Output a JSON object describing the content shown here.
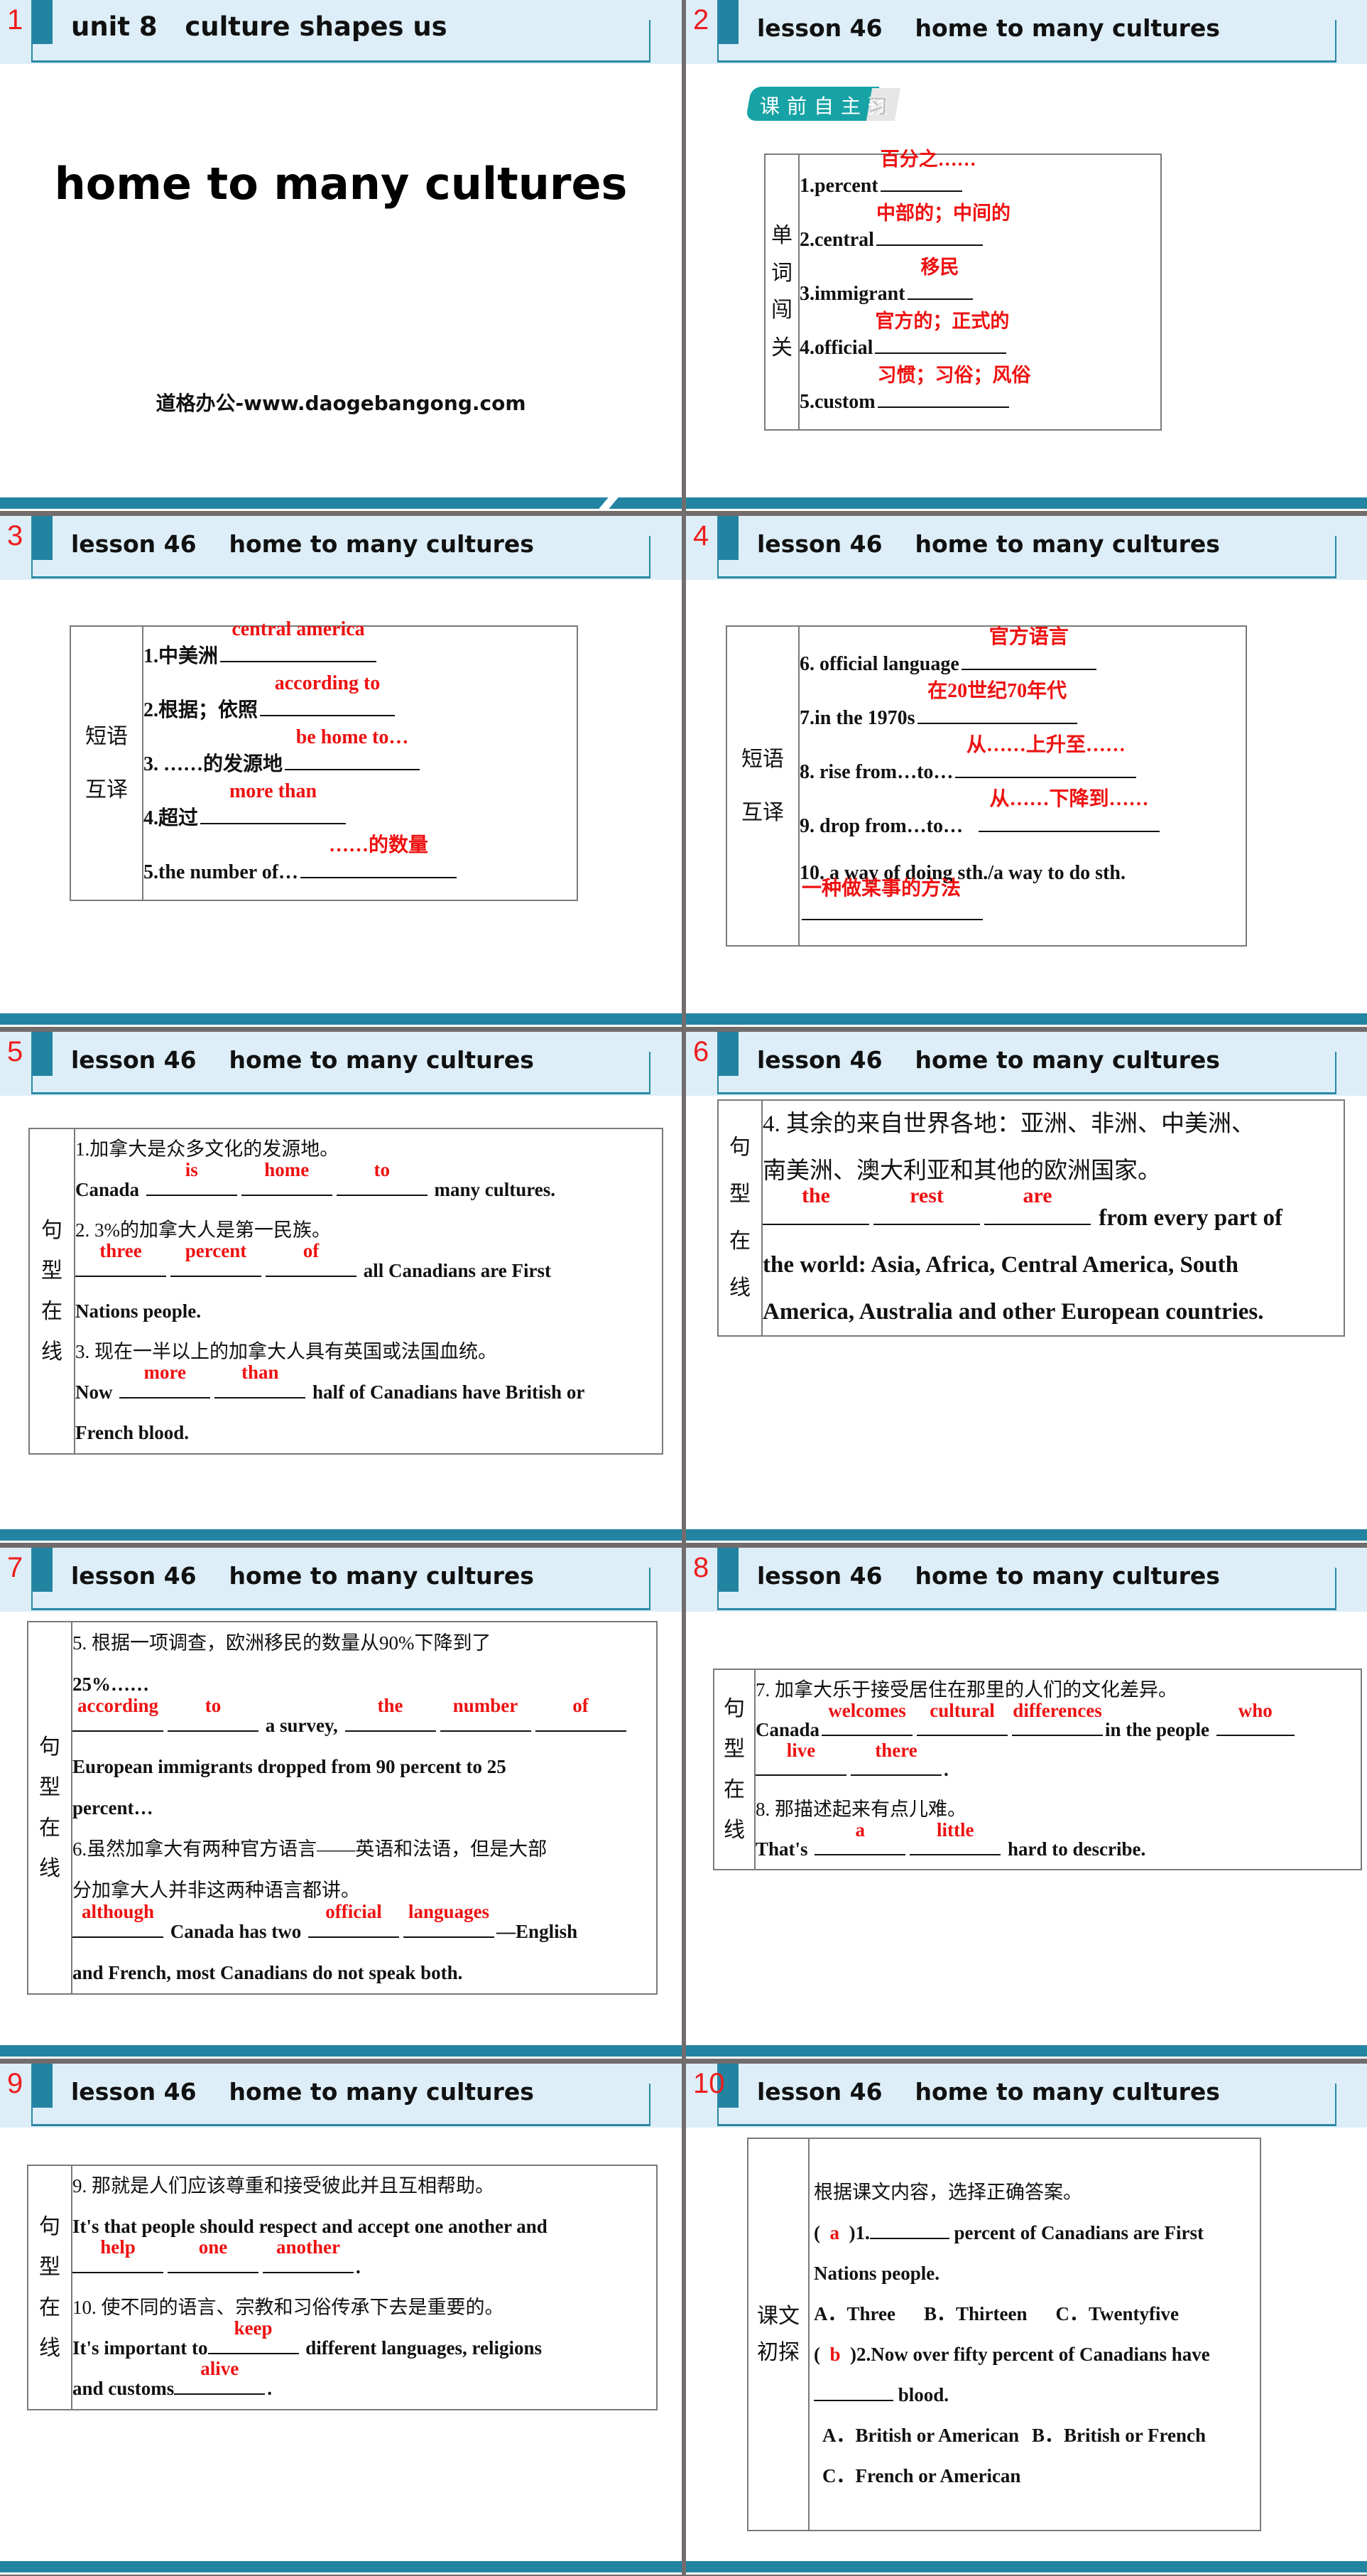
{
  "colors": {
    "header_bg": "#ddeef8",
    "accent": "#2384a2",
    "answer": "#ee1111",
    "badge": "#17a3a6"
  },
  "slides": [
    {
      "number": "1",
      "header": "unit 8   culture shapes us",
      "title": "home to many cultures",
      "site": "道格办公-www.daogebangong.com"
    },
    {
      "number": "2",
      "header": "lesson 46    home to many cultures",
      "badge": {
        "text": "课前自主预",
        "tail": "习"
      },
      "label": [
        "单",
        "词",
        "闯",
        "关"
      ],
      "items": [
        {
          "prompt": "1.percent",
          "answer": "百分之……"
        },
        {
          "prompt": "2.central",
          "answer": "中部的；中间的"
        },
        {
          "prompt": "3.immigrant",
          "answer": "移民"
        },
        {
          "prompt": "4.official",
          "answer": "官方的；正式的"
        },
        {
          "prompt": "5.custom",
          "answer": "习惯；习俗；风俗"
        }
      ]
    },
    {
      "number": "3",
      "header": "lesson 46    home to many cultures",
      "label": [
        "短语",
        "互译"
      ],
      "items": [
        {
          "prompt": "1.中美洲",
          "answer": "central america"
        },
        {
          "prompt": "2.根据；依照",
          "answer": "according to"
        },
        {
          "prompt": "3. ……的发源地",
          "answer": "be home to…"
        },
        {
          "prompt": "4.超过",
          "answer": "more than"
        },
        {
          "prompt": "5.the number of…",
          "answer": "……的数量"
        }
      ]
    },
    {
      "number": "4",
      "header": "lesson 46    home to many cultures",
      "label": [
        "短语",
        "互译"
      ],
      "items": [
        {
          "prompt": "6. official language",
          "answer": "官方语言"
        },
        {
          "prompt": "7.in the 1970s",
          "answer": "在20世纪70年代"
        },
        {
          "prompt": "8.  rise from…to…",
          "answer": "从……上升至……"
        },
        {
          "prompt": "9.  drop from…to…",
          "answer": "从……下降到……"
        },
        {
          "prompt": "10.  a way of doing sth./a way to do sth.",
          "answer": "一种做某事的方法"
        }
      ]
    },
    {
      "number": "5",
      "header": "lesson 46    home to many cultures",
      "label": [
        "句",
        "型",
        "在",
        "线"
      ],
      "q1": {
        "zh": "1.加拿大是众多文化的发源地。",
        "pre": "Canada",
        "answers": [
          "is",
          "home",
          "to"
        ],
        "post": "many cultures."
      },
      "q2": {
        "zh": "2.  3%的加拿大人是第一民族。",
        "answers": [
          "three",
          "percent",
          "of"
        ],
        "post": "all Canadians are First",
        "post2": "Nations people."
      },
      "q3": {
        "zh": "3.  现在一半以上的加拿大人具有英国或法国血统。",
        "pre": "Now",
        "answers": [
          "more",
          "than"
        ],
        "post": "half of Canadians have British or",
        "post2": "French blood."
      }
    },
    {
      "number": "6",
      "header": "lesson 46    home to many cultures",
      "label": [
        "句",
        "型",
        "在",
        "线"
      ],
      "q4": {
        "zh1": "4.  其余的来自世界各地：亚洲、非洲、中美洲、",
        "zh2": "南美洲、澳大利亚和其他的欧洲国家。",
        "answers": [
          "the",
          "rest",
          "are"
        ],
        "post": "from every part of",
        "post2": "the world: Asia, Africa, Central America, South",
        "post3": "America, Australia and other European countries."
      }
    },
    {
      "number": "7",
      "header": "lesson 46    home to many cultures",
      "label": [
        "句",
        "型",
        "在",
        "线"
      ],
      "q5": {
        "zh1": "5.  根据一项调查，欧洲移民的数量从90%下降到了",
        "zh2": "25%……",
        "answers_a": [
          "according",
          "to"
        ],
        "mid": "a survey,",
        "answers_b": [
          "the",
          "number",
          "of"
        ],
        "post": "European immigrants dropped from 90 percent to 25",
        "post2": "percent…"
      },
      "q6": {
        "zh1": "6.虽然加拿大有两种官方语言——英语和法语，但是大部",
        "zh2": "分加拿大人并非这两种语言都讲。",
        "answer_a": "although",
        "mid": "Canada has two",
        "answers_b": [
          "official",
          "languages"
        ],
        "post": "—English",
        "post2": "and French, most Canadians do not speak both."
      }
    },
    {
      "number": "8",
      "header": "lesson 46    home to many cultures",
      "label": [
        "句",
        "型",
        "在",
        "线"
      ],
      "q7": {
        "zh": "7.  加拿大乐于接受居住在那里的人们的文化差异。",
        "pre": "Canada",
        "answers_a": [
          "welcomes",
          "cultural",
          "differences"
        ],
        "mid": "in the people",
        "answer_b": "who",
        "answers_c": [
          "live",
          "there"
        ]
      },
      "q8": {
        "zh": "8.  那描述起来有点儿难。",
        "pre": "That's",
        "answers": [
          "a",
          "little"
        ],
        "post": "hard to describe."
      }
    },
    {
      "number": "9",
      "header": "lesson 46    home to many cultures",
      "label": [
        "句",
        "型",
        "在",
        "线"
      ],
      "q9": {
        "zh": "9.  那就是人们应该尊重和接受彼此并且互相帮助。",
        "pre": "It's that people should respect and accept one another and",
        "answers": [
          "help",
          "one",
          "another"
        ]
      },
      "q10": {
        "zh": "10.  使不同的语言、宗教和习俗传承下去是重要的。",
        "pre": "It's important to",
        "answer_a": "keep",
        "post": "different languages, religions",
        "pre2": "and customs",
        "answer_b": "alive"
      }
    },
    {
      "number": "10",
      "header": "lesson 46    home to many cultures",
      "label": [
        "课文",
        "初探"
      ],
      "instruction": "根据课文内容，选择正确答案。",
      "mc": [
        {
          "answer": "a",
          "num": ")1.",
          "stem": "percent of Canadians are First",
          "stem2": "Nations people.",
          "options": [
            "A．Three",
            "B．Thirteen",
            "C．Twentyfive"
          ]
        },
        {
          "answer": "b",
          "num": ")2.",
          "stem": "Now over fifty percent of Canadians have",
          "stem2": "blood.",
          "options": [
            "A．British or American",
            "B．British or French",
            "C．French or American"
          ]
        }
      ]
    }
  ]
}
